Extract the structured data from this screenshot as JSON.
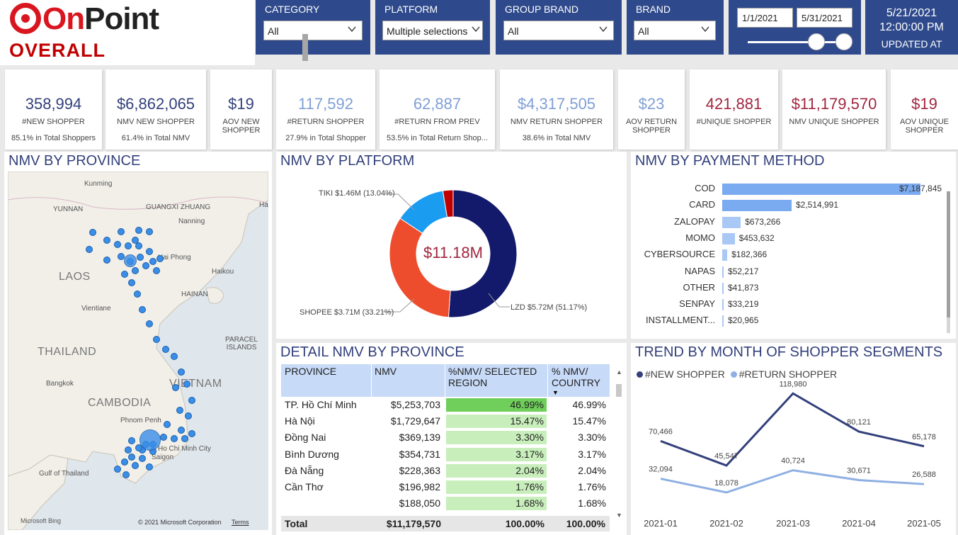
{
  "header": {
    "logo_on": "On",
    "logo_point": "Point",
    "page_title": "OVERALL",
    "updated_date": "5/21/2021",
    "updated_time": "12:00:00 PM",
    "updated_label": "UPDATED AT"
  },
  "filters": {
    "category": {
      "label": "CATEGORY",
      "value": "All"
    },
    "platform": {
      "label": "PLATFORM",
      "value": "Multiple selections"
    },
    "group_brand": {
      "label": "GROUP BRAND",
      "value": "All"
    },
    "brand": {
      "label": "BRAND",
      "value": "All"
    },
    "date_start": "1/1/2021",
    "date_end": "5/31/2021"
  },
  "kpis": [
    {
      "value": "358,994",
      "label": "#NEW SHOPPER",
      "sub": "85.1% in Total Shoppers"
    },
    {
      "value": "$6,862,065",
      "label": "NMV NEW SHOPPER",
      "sub": "61.4% in Total NMV"
    },
    {
      "value": "$19",
      "label": "AOV NEW SHOPPER",
      "sub": ""
    },
    {
      "value": "117,592",
      "label": "#RETURN SHOPPER",
      "sub": "27.9% in Total Shopper"
    },
    {
      "value": "62,887",
      "label": "#RETURN FROM PREV",
      "sub": "53.5% in Total Return Shop..."
    },
    {
      "value": "$4,317,505",
      "label": "NMV RETURN SHOPPER",
      "sub": "38.6% in Total NMV"
    },
    {
      "value": "$23",
      "label": "AOV RETURN SHOPPER",
      "sub": ""
    },
    {
      "value": "421,881",
      "label": "#UNIQUE SHOPPER",
      "sub": ""
    },
    {
      "value": "$11,179,570",
      "label": "NMV UNIQUE SHOPPER",
      "sub": ""
    },
    {
      "value": "$19",
      "label": "AOV UNIQUE SHOPPER",
      "sub": ""
    }
  ],
  "map_panel": {
    "title": "NMV BY PROVINCE",
    "labels": {
      "kunming": "Kunming",
      "yunnan": "YUNNAN",
      "guangxi": "GUANGXI ZHUANG",
      "nanning": "Nanning",
      "ha": "Ha",
      "haiphong": "Hai Phong",
      "laos": "LAOS",
      "haikou": "Haikou",
      "hainan": "HAINAN",
      "vientiane": "Vientiane",
      "paracel": "PARACEL ISLANDS",
      "thailand": "THAILAND",
      "bangkok": "Bangkok",
      "vietnam": "VIETNAM",
      "cambodia": "CAMBODIA",
      "phnompenh": "Phnom Penh",
      "hcmc": "Ho Chi Minh City",
      "saigon": "Saigon",
      "gulf": "Gulf of Thailand",
      "bing": "Microsoft Bing",
      "copyright": "© 2021 Microsoft Corporation",
      "terms": "Terms"
    }
  },
  "platform_panel": {
    "title": "NMV BY PLATFORM",
    "center_label": "$11.18M",
    "label_tiki": "TIKI $1.46M (13.04%)",
    "label_shopee": "SHOPEE $3.71M (33.21%)",
    "label_lzd": "LZD $5.72M (51.17%)"
  },
  "payment_panel": {
    "title": "NMV BY PAYMENT METHOD",
    "rows": [
      {
        "label": "COD",
        "value_text": "$7,187,845"
      },
      {
        "label": "CARD",
        "value_text": "$2,514,991"
      },
      {
        "label": "ZALOPAY",
        "value_text": "$673,266"
      },
      {
        "label": "MOMO",
        "value_text": "$453,632"
      },
      {
        "label": "CYBERSOURCE",
        "value_text": "$182,366"
      },
      {
        "label": "NAPAS",
        "value_text": "$52,217"
      },
      {
        "label": "OTHER",
        "value_text": "$41,873"
      },
      {
        "label": "SENPAY",
        "value_text": "$33,219"
      },
      {
        "label": "INSTALLMENT...",
        "value_text": "$20,965"
      }
    ]
  },
  "detail_panel": {
    "title": "DETAIL NMV BY PROVINCE",
    "headers": {
      "province": "PROVINCE",
      "nmv": "NMV",
      "pct_region": "%NMV/ SELECTED REGION",
      "pct_country": "% NMV/ COUNTRY"
    },
    "rows": [
      {
        "province": "TP. Hồ Chí Minh",
        "nmv": "$5,253,703",
        "pct_region": "46.99%",
        "pct_country": "46.99%"
      },
      {
        "province": "Hà Nội",
        "nmv": "$1,729,647",
        "pct_region": "15.47%",
        "pct_country": "15.47%"
      },
      {
        "province": "Đồng Nai",
        "nmv": "$369,139",
        "pct_region": "3.30%",
        "pct_country": "3.30%"
      },
      {
        "province": "Bình Dương",
        "nmv": "$354,731",
        "pct_region": "3.17%",
        "pct_country": "3.17%"
      },
      {
        "province": "Đà Nẵng",
        "nmv": "$228,363",
        "pct_region": "2.04%",
        "pct_country": "2.04%"
      },
      {
        "province": "Cần Thơ",
        "nmv": "$196,982",
        "pct_region": "1.76%",
        "pct_country": "1.76%"
      },
      {
        "province": "",
        "nmv": "$188,050",
        "pct_region": "1.68%",
        "pct_country": "1.68%"
      }
    ],
    "total": {
      "label": "Total",
      "nmv": "$11,179,570",
      "pct_region": "100.00%",
      "pct_country": "100.00%"
    }
  },
  "trend_panel": {
    "title": "TREND BY MONTH OF SHOPPER SEGMENTS"
  },
  "colors": {
    "navy": "#33407b",
    "light_blue": "#8fb0e3",
    "header_blue": "#2f4a8c",
    "red": "#a1263f",
    "lzd": "#141a6b",
    "shopee": "#ee4d2d",
    "tiki": "#1a9cf0",
    "other": "#c00000"
  },
  "chart_data": [
    {
      "type": "pie",
      "title": "NMV BY PLATFORM",
      "categories": [
        "LZD",
        "SHOPEE",
        "TIKI",
        ""
      ],
      "values": [
        5.72,
        3.71,
        1.46,
        0.29
      ]
    },
    {
      "type": "bar",
      "title": "NMV BY PAYMENT METHOD",
      "categories": [
        "COD",
        "CARD",
        "ZALOPAY",
        "MOMO",
        "CYBERSOURCE",
        "NAPAS",
        "OTHER",
        "SENPAY",
        "INSTALLMENT..."
      ],
      "values": [
        7187845,
        2514991,
        673266,
        453632,
        182366,
        52217,
        41873,
        33219,
        20965
      ]
    },
    {
      "type": "bar",
      "title": "DETAIL NMV BY PROVINCE",
      "categories": [
        "TP. Hồ Chí Minh",
        "Hà Nội",
        "Đồng Nai",
        "Bình Dương",
        "Đà Nẵng",
        "Cần Thơ",
        ""
      ],
      "values": [
        46.99,
        15.47,
        3.3,
        3.17,
        2.04,
        1.76,
        1.68
      ]
    },
    {
      "type": "line",
      "title": "TREND BY MONTH OF SHOPPER SEGMENTS",
      "x": [
        "2021-01",
        "2021-02",
        "2021-03",
        "2021-04",
        "2021-05"
      ],
      "series": [
        {
          "name": "#NEW SHOPPER",
          "values": [
            70466,
            45547,
            118980,
            80121,
            65178
          ],
          "labels": [
            "70,466",
            "45,547",
            "118,980",
            "80,121",
            "65,178"
          ]
        },
        {
          "name": "#RETURN SHOPPER",
          "values": [
            32094,
            18078,
            40724,
            30671,
            26588
          ],
          "labels": [
            "32,094",
            "18,078",
            "40,724",
            "30,671",
            "26,588"
          ]
        }
      ]
    }
  ]
}
